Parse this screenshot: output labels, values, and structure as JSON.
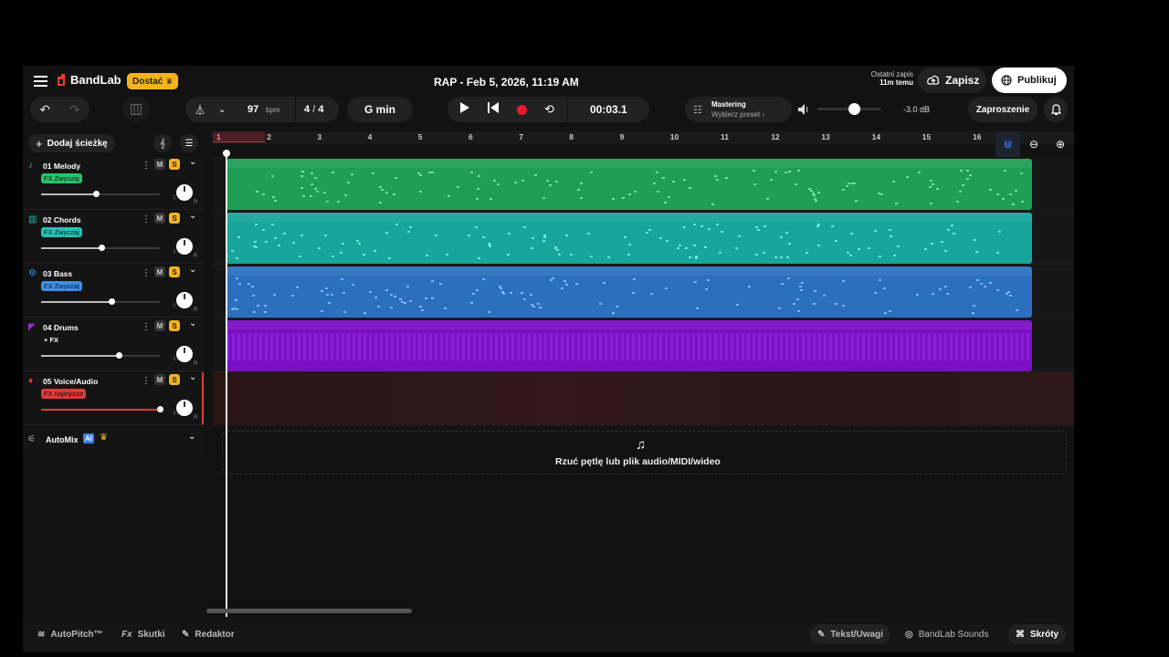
{
  "app": {
    "logo": "BandLab",
    "upgrade_label": "Dostać",
    "title": "RAP - Feb 5, 2026, 11:19 AM",
    "last_saved_label": "Ostatni zapis",
    "last_saved_time": "11m temu",
    "save_label": "Zapisz",
    "publish_label": "Publikuj",
    "invite_label": "Zaproszenie"
  },
  "toolbar": {
    "bpm_value": "97",
    "bpm_unit": "bpm",
    "time_sig_num": "4",
    "time_sig_sep": "/",
    "time_sig_den": "4",
    "key": "G min",
    "time_display": "00:03.1",
    "mastering_label": "Mastering",
    "mastering_preset": "Wybierz preset ›",
    "volume_db": "-3.0 dB",
    "volume_level": 0.6
  },
  "sidebar": {
    "add_track_label": "Dodaj ścieżkę",
    "automix_label": "AutoMix",
    "automix_badge": "AI",
    "tracks": [
      {
        "name": "01  Melody",
        "fx": "FX Zwyczaj",
        "color": "#29c26b",
        "icon": "piano-hand-icon",
        "volume": 0.46
      },
      {
        "name": "02  Chords",
        "fx": "FX Zwyczaj",
        "color": "#22c3b5",
        "icon": "keyboard-icon",
        "volume": 0.51
      },
      {
        "name": "03  Bass",
        "fx": "FX Zwyczaj",
        "color": "#3d8fe6",
        "icon": "bass-gear-icon",
        "volume": 0.59
      },
      {
        "name": "04  Drums",
        "fx": "+ FX",
        "color": "#9c2fd6",
        "icon": "drum-icon",
        "volume": 0.65
      },
      {
        "name": "05  Voice/Audio",
        "fx": "FX najlepsze",
        "color": "#e03a3a",
        "icon": "microphone-icon",
        "volume": 1.0
      }
    ],
    "mute_label": "M",
    "solo_label": "S",
    "pan_left": "L",
    "pan_right": "R"
  },
  "timeline": {
    "ruler": [
      "1",
      "2",
      "3",
      "4",
      "5",
      "6",
      "7",
      "8",
      "9",
      "10",
      "11",
      "12",
      "13",
      "14",
      "15",
      "16"
    ],
    "drop_text": "Rzuć pętlę lub plik audio/MIDI/wideo"
  },
  "bottom": {
    "autopitch": "AutoPitch™",
    "effects": "Skutki",
    "editor": "Redaktor",
    "lyrics": "Tekst/Uwagi",
    "sounds": "BandLab Sounds",
    "shortcuts": "Skróty"
  },
  "colors": {
    "accent": "#f5b41e",
    "record": "#e8192c",
    "bg": "#121212"
  }
}
